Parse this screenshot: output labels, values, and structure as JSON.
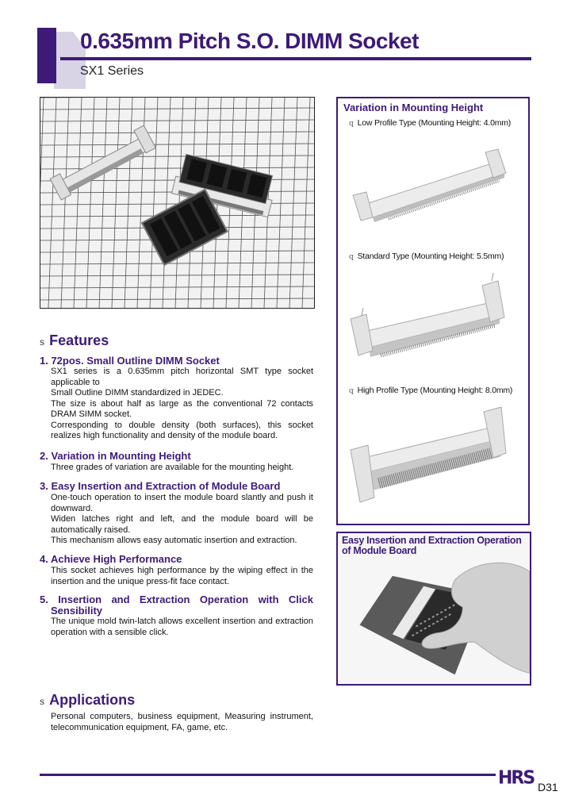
{
  "header": {
    "title": "0.635mm Pitch S.O. DIMM Socket",
    "subtitle": "SX1 Series"
  },
  "colors": {
    "accent": "#3d1a78",
    "accent_light": "#d9d3e6"
  },
  "product_photo": {
    "description": "SX1 sockets and S.O. DIMM module on grid background"
  },
  "variation_box": {
    "title": "Variation in Mounting Height",
    "bullet_glyph": "q",
    "items": [
      {
        "label": "Low Profile Type (Mounting Height: 4.0mm)"
      },
      {
        "label": "Standard Type (Mounting Height: 5.5mm)"
      },
      {
        "label": "High Profile Type (Mounting Height: 8.0mm)"
      }
    ]
  },
  "insertion_box": {
    "title": "Easy Insertion and Extraction Operation of Module Board"
  },
  "features": {
    "section_mark": "s",
    "heading": "Features",
    "items": [
      {
        "title": "1. 72pos. Small Outline DIMM Socket",
        "paragraphs": [
          "SX1 series is a 0.635mm pitch horizontal SMT type socket applicable to",
          "Small Outline DIMM standardized in JEDEC.",
          "The size is about half as large as the conventional 72 contacts DRAM SIMM socket.",
          "Corresponding to double density (both surfaces), this socket realizes high functionality and density of the module board."
        ]
      },
      {
        "title": "2. Variation in Mounting Height",
        "paragraphs": [
          "Three grades of variation are available for the mounting height."
        ]
      },
      {
        "title": "3. Easy Insertion and Extraction of Module Board",
        "paragraphs": [
          "One-touch operation to insert the module board slantly and push it downward.",
          "Widen latches right and left, and the module board will be automatically raised.",
          "This mechanism allows easy automatic insertion and extraction."
        ]
      },
      {
        "title": "4. Achieve High Performance",
        "paragraphs": [
          "This socket achieves high performance by the wiping effect in the insertion and the unique press-fit face contact."
        ]
      },
      {
        "title_line1": "5. Insertion and Extraction Operation with Click",
        "title_line2": "Sensibility",
        "paragraphs": [
          "The unique mold twin-latch allows excellent insertion and extraction operation with a sensible click."
        ]
      }
    ]
  },
  "applications": {
    "section_mark": "s",
    "heading": "Applications",
    "text": "Personal computers, business equipment, Measuring instrument, telecommunication equipment, FA, game, etc."
  },
  "footer": {
    "logo": "HRS",
    "page_number": "D31"
  }
}
